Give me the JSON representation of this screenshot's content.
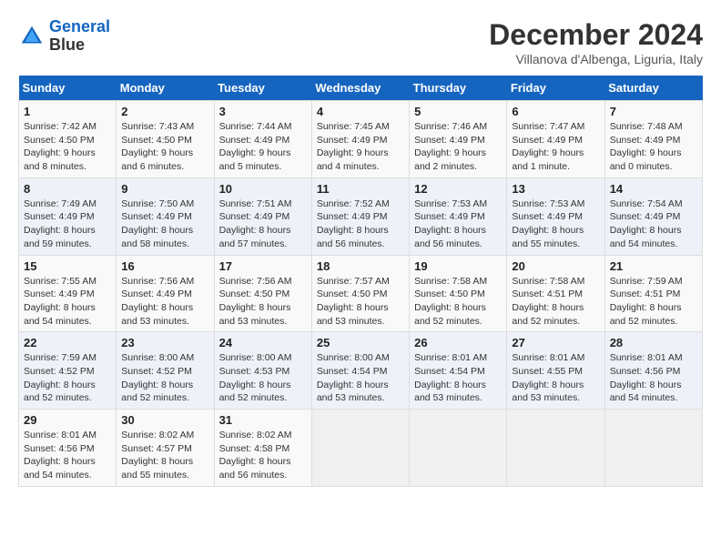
{
  "header": {
    "logo_line1": "General",
    "logo_line2": "Blue",
    "month_title": "December 2024",
    "subtitle": "Villanova d'Albenga, Liguria, Italy"
  },
  "weekdays": [
    "Sunday",
    "Monday",
    "Tuesday",
    "Wednesday",
    "Thursday",
    "Friday",
    "Saturday"
  ],
  "weeks": [
    [
      {
        "day": "1",
        "sunrise": "7:42 AM",
        "sunset": "4:50 PM",
        "daylight": "9 hours and 8 minutes."
      },
      {
        "day": "2",
        "sunrise": "7:43 AM",
        "sunset": "4:50 PM",
        "daylight": "9 hours and 6 minutes."
      },
      {
        "day": "3",
        "sunrise": "7:44 AM",
        "sunset": "4:49 PM",
        "daylight": "9 hours and 5 minutes."
      },
      {
        "day": "4",
        "sunrise": "7:45 AM",
        "sunset": "4:49 PM",
        "daylight": "9 hours and 4 minutes."
      },
      {
        "day": "5",
        "sunrise": "7:46 AM",
        "sunset": "4:49 PM",
        "daylight": "9 hours and 2 minutes."
      },
      {
        "day": "6",
        "sunrise": "7:47 AM",
        "sunset": "4:49 PM",
        "daylight": "9 hours and 1 minute."
      },
      {
        "day": "7",
        "sunrise": "7:48 AM",
        "sunset": "4:49 PM",
        "daylight": "9 hours and 0 minutes."
      }
    ],
    [
      {
        "day": "8",
        "sunrise": "7:49 AM",
        "sunset": "4:49 PM",
        "daylight": "8 hours and 59 minutes."
      },
      {
        "day": "9",
        "sunrise": "7:50 AM",
        "sunset": "4:49 PM",
        "daylight": "8 hours and 58 minutes."
      },
      {
        "day": "10",
        "sunrise": "7:51 AM",
        "sunset": "4:49 PM",
        "daylight": "8 hours and 57 minutes."
      },
      {
        "day": "11",
        "sunrise": "7:52 AM",
        "sunset": "4:49 PM",
        "daylight": "8 hours and 56 minutes."
      },
      {
        "day": "12",
        "sunrise": "7:53 AM",
        "sunset": "4:49 PM",
        "daylight": "8 hours and 56 minutes."
      },
      {
        "day": "13",
        "sunrise": "7:53 AM",
        "sunset": "4:49 PM",
        "daylight": "8 hours and 55 minutes."
      },
      {
        "day": "14",
        "sunrise": "7:54 AM",
        "sunset": "4:49 PM",
        "daylight": "8 hours and 54 minutes."
      }
    ],
    [
      {
        "day": "15",
        "sunrise": "7:55 AM",
        "sunset": "4:49 PM",
        "daylight": "8 hours and 54 minutes."
      },
      {
        "day": "16",
        "sunrise": "7:56 AM",
        "sunset": "4:49 PM",
        "daylight": "8 hours and 53 minutes."
      },
      {
        "day": "17",
        "sunrise": "7:56 AM",
        "sunset": "4:50 PM",
        "daylight": "8 hours and 53 minutes."
      },
      {
        "day": "18",
        "sunrise": "7:57 AM",
        "sunset": "4:50 PM",
        "daylight": "8 hours and 53 minutes."
      },
      {
        "day": "19",
        "sunrise": "7:58 AM",
        "sunset": "4:50 PM",
        "daylight": "8 hours and 52 minutes."
      },
      {
        "day": "20",
        "sunrise": "7:58 AM",
        "sunset": "4:51 PM",
        "daylight": "8 hours and 52 minutes."
      },
      {
        "day": "21",
        "sunrise": "7:59 AM",
        "sunset": "4:51 PM",
        "daylight": "8 hours and 52 minutes."
      }
    ],
    [
      {
        "day": "22",
        "sunrise": "7:59 AM",
        "sunset": "4:52 PM",
        "daylight": "8 hours and 52 minutes."
      },
      {
        "day": "23",
        "sunrise": "8:00 AM",
        "sunset": "4:52 PM",
        "daylight": "8 hours and 52 minutes."
      },
      {
        "day": "24",
        "sunrise": "8:00 AM",
        "sunset": "4:53 PM",
        "daylight": "8 hours and 52 minutes."
      },
      {
        "day": "25",
        "sunrise": "8:00 AM",
        "sunset": "4:54 PM",
        "daylight": "8 hours and 53 minutes."
      },
      {
        "day": "26",
        "sunrise": "8:01 AM",
        "sunset": "4:54 PM",
        "daylight": "8 hours and 53 minutes."
      },
      {
        "day": "27",
        "sunrise": "8:01 AM",
        "sunset": "4:55 PM",
        "daylight": "8 hours and 53 minutes."
      },
      {
        "day": "28",
        "sunrise": "8:01 AM",
        "sunset": "4:56 PM",
        "daylight": "8 hours and 54 minutes."
      }
    ],
    [
      {
        "day": "29",
        "sunrise": "8:01 AM",
        "sunset": "4:56 PM",
        "daylight": "8 hours and 54 minutes."
      },
      {
        "day": "30",
        "sunrise": "8:02 AM",
        "sunset": "4:57 PM",
        "daylight": "8 hours and 55 minutes."
      },
      {
        "day": "31",
        "sunrise": "8:02 AM",
        "sunset": "4:58 PM",
        "daylight": "8 hours and 56 minutes."
      },
      null,
      null,
      null,
      null
    ]
  ]
}
